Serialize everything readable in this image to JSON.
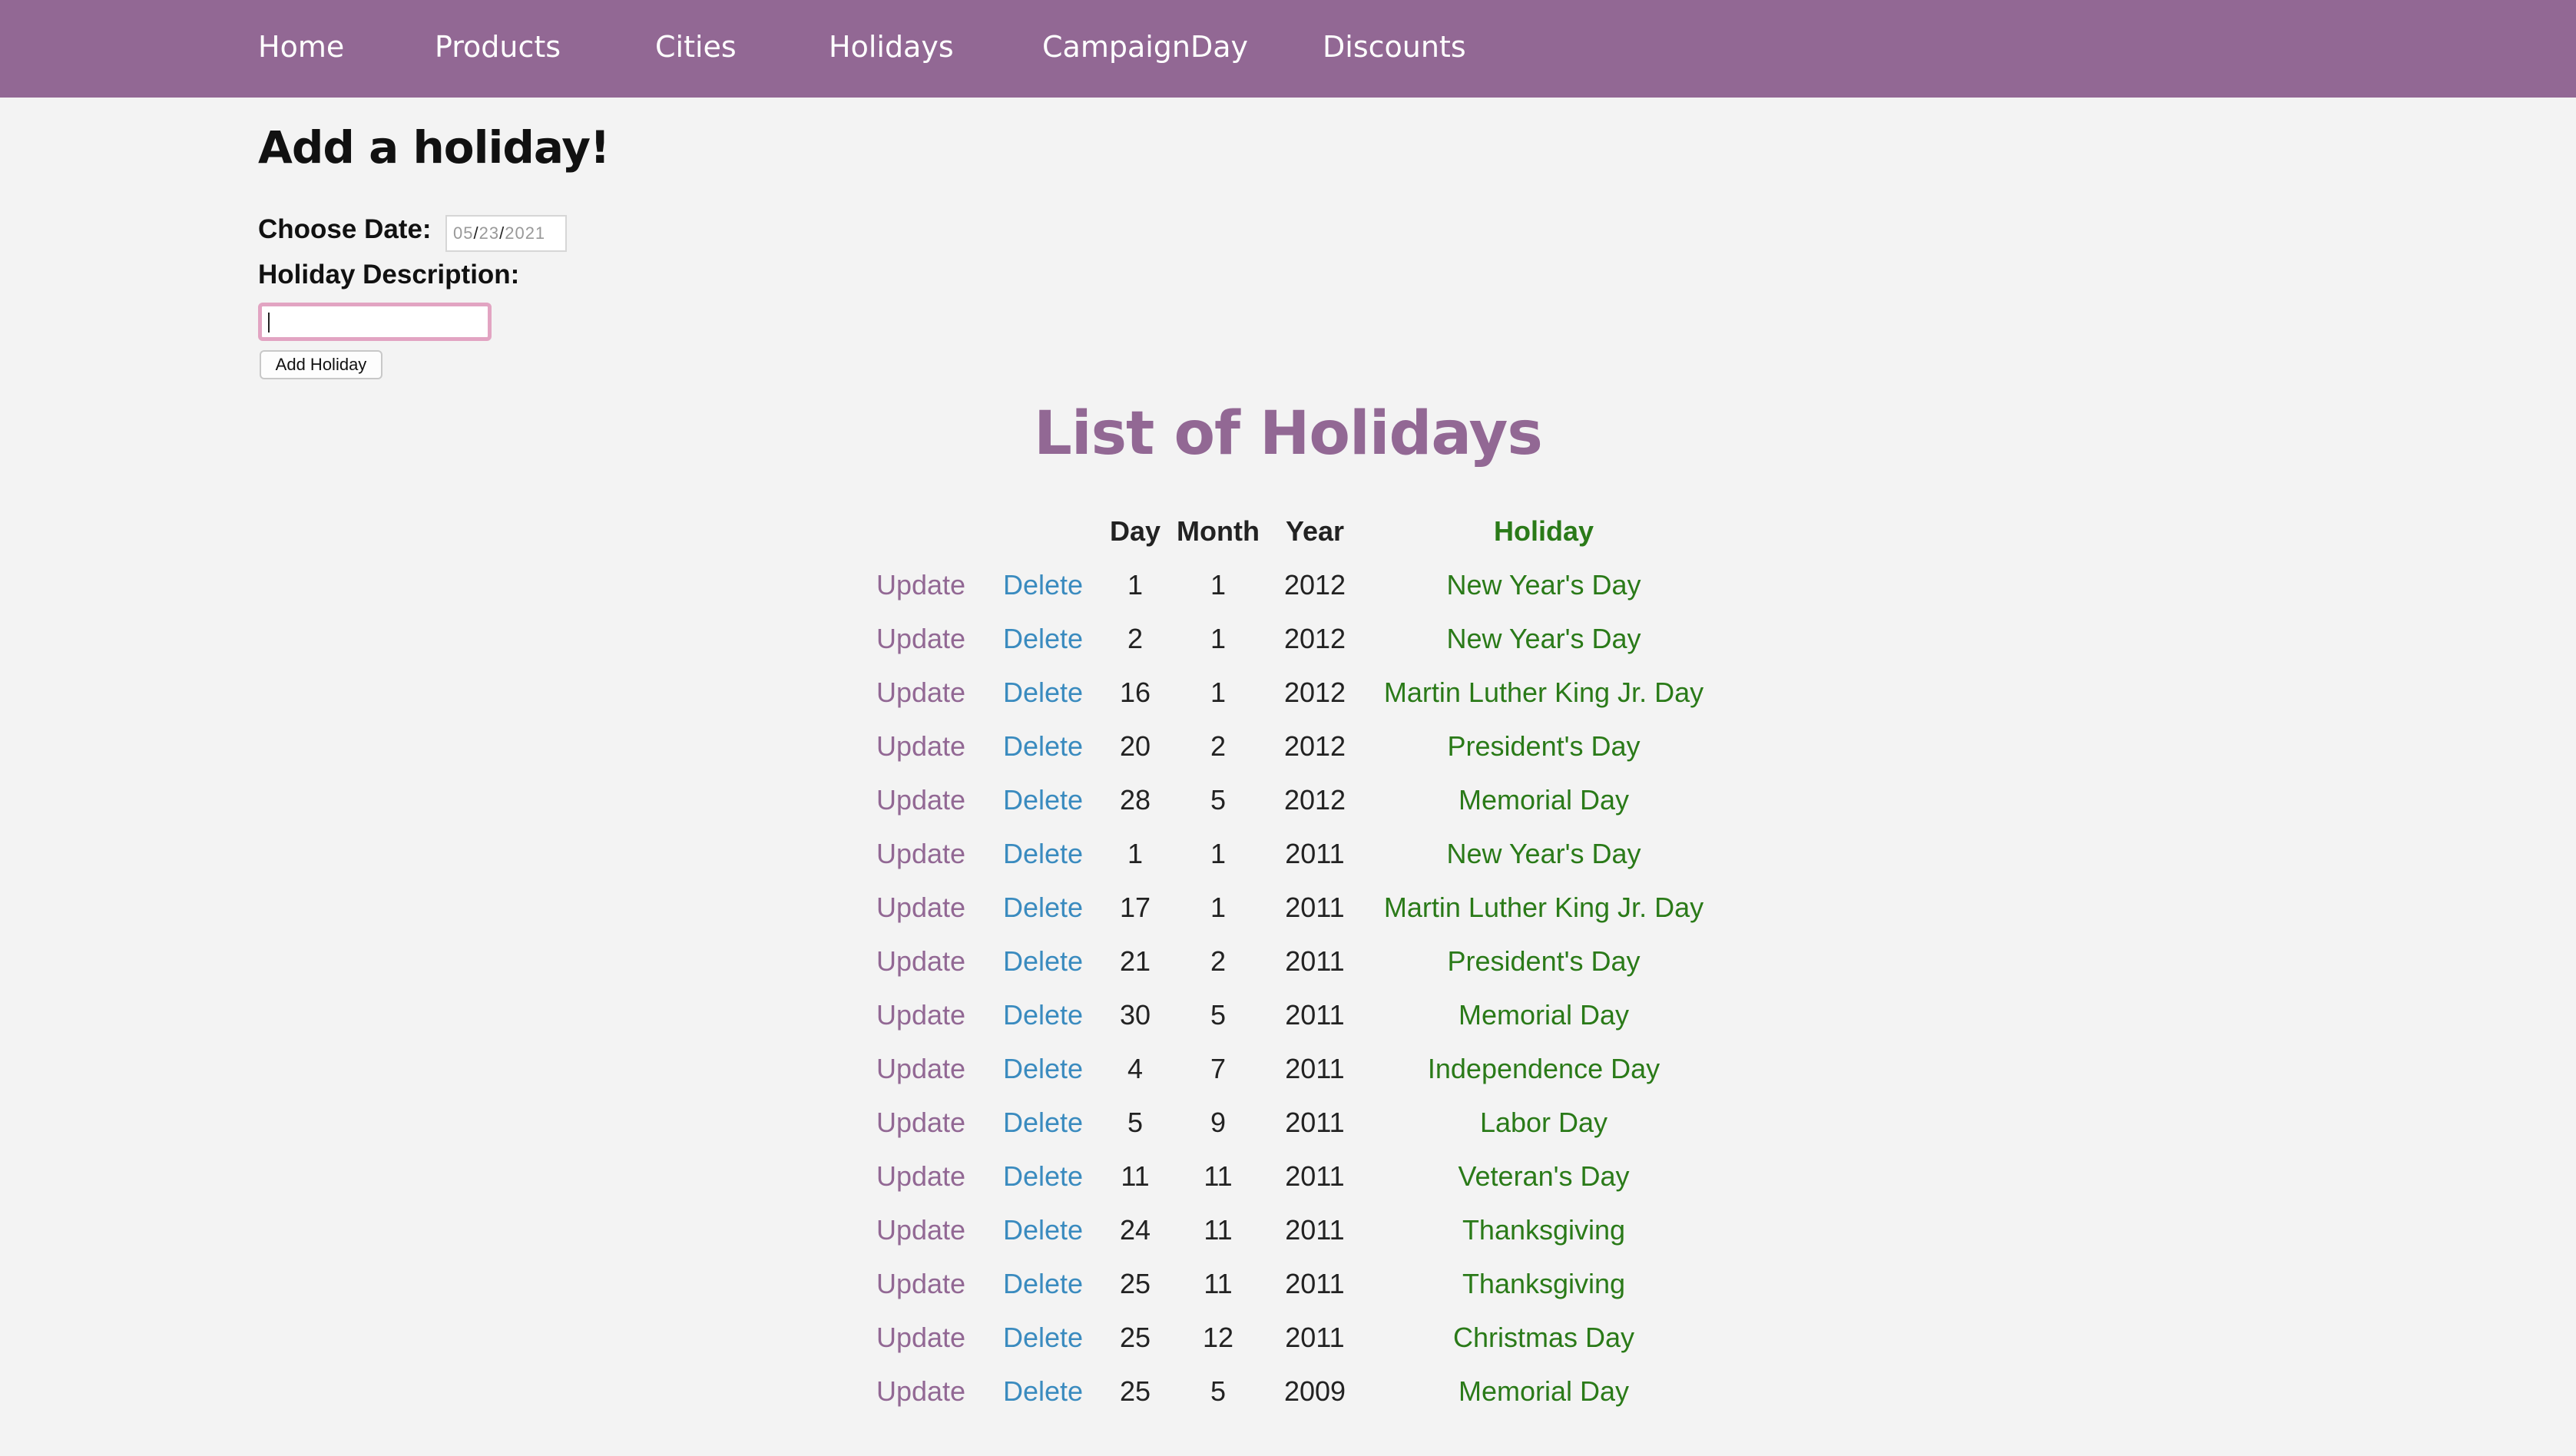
{
  "nav": [
    {
      "label": "Home"
    },
    {
      "label": "Products"
    },
    {
      "label": "Cities"
    },
    {
      "label": "Holidays"
    },
    {
      "label": "CampaignDay"
    },
    {
      "label": "Discounts"
    }
  ],
  "form": {
    "heading": "Add a holiday!",
    "date_label": "Choose Date:",
    "date_value": {
      "month": "05",
      "day": "23",
      "year": "2021"
    },
    "description_label": "Holiday Description:",
    "description_value": "",
    "add_button": "Add Holiday"
  },
  "list": {
    "title": "List of Holidays",
    "columns": [
      "Day",
      "Month",
      "Year",
      "Holiday"
    ],
    "update_label": "Update",
    "delete_label": "Delete",
    "rows": [
      {
        "day": "1",
        "month": "1",
        "year": "2012",
        "holiday": "New Year's Day"
      },
      {
        "day": "2",
        "month": "1",
        "year": "2012",
        "holiday": "New Year's Day"
      },
      {
        "day": "16",
        "month": "1",
        "year": "2012",
        "holiday": "Martin Luther King Jr. Day"
      },
      {
        "day": "20",
        "month": "2",
        "year": "2012",
        "holiday": "President's Day"
      },
      {
        "day": "28",
        "month": "5",
        "year": "2012",
        "holiday": "Memorial Day"
      },
      {
        "day": "1",
        "month": "1",
        "year": "2011",
        "holiday": "New Year's Day"
      },
      {
        "day": "17",
        "month": "1",
        "year": "2011",
        "holiday": "Martin Luther King Jr. Day"
      },
      {
        "day": "21",
        "month": "2",
        "year": "2011",
        "holiday": "President's Day"
      },
      {
        "day": "30",
        "month": "5",
        "year": "2011",
        "holiday": "Memorial Day"
      },
      {
        "day": "4",
        "month": "7",
        "year": "2011",
        "holiday": "Independence Day"
      },
      {
        "day": "5",
        "month": "9",
        "year": "2011",
        "holiday": "Labor Day"
      },
      {
        "day": "11",
        "month": "11",
        "year": "2011",
        "holiday": "Veteran's Day"
      },
      {
        "day": "24",
        "month": "11",
        "year": "2011",
        "holiday": "Thanksgiving"
      },
      {
        "day": "25",
        "month": "11",
        "year": "2011",
        "holiday": "Thanksgiving"
      },
      {
        "day": "25",
        "month": "12",
        "year": "2011",
        "holiday": "Christmas Day"
      },
      {
        "day": "25",
        "month": "5",
        "year": "2009",
        "holiday": "Memorial Day"
      }
    ]
  },
  "colors": {
    "nav_bg": "#926894",
    "title": "#926894",
    "update_link": "#926894",
    "delete_link": "#3a8bbf",
    "holiday_text": "#2a7a18",
    "input_focus": "#e2a4c2"
  }
}
